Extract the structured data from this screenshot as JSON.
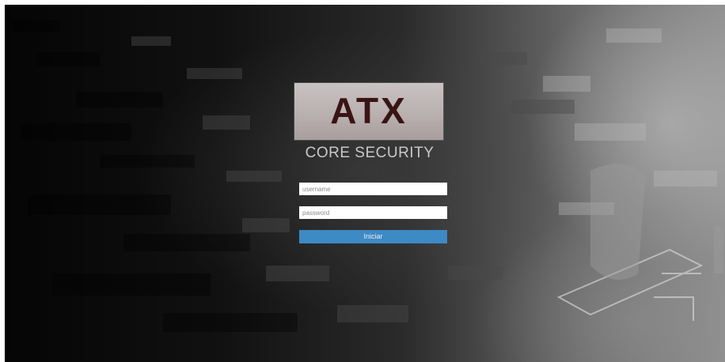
{
  "logo": {
    "text": "ATX"
  },
  "brand": {
    "subtitle": "CORE SECURITY"
  },
  "form": {
    "username_placeholder": "username",
    "username_value": "",
    "password_placeholder": "password",
    "password_value": "",
    "submit_label": "Iniciar"
  },
  "colors": {
    "button": "#3d8ac4",
    "logo_background": "#bcb2b2",
    "logo_text": "#3a1414"
  }
}
